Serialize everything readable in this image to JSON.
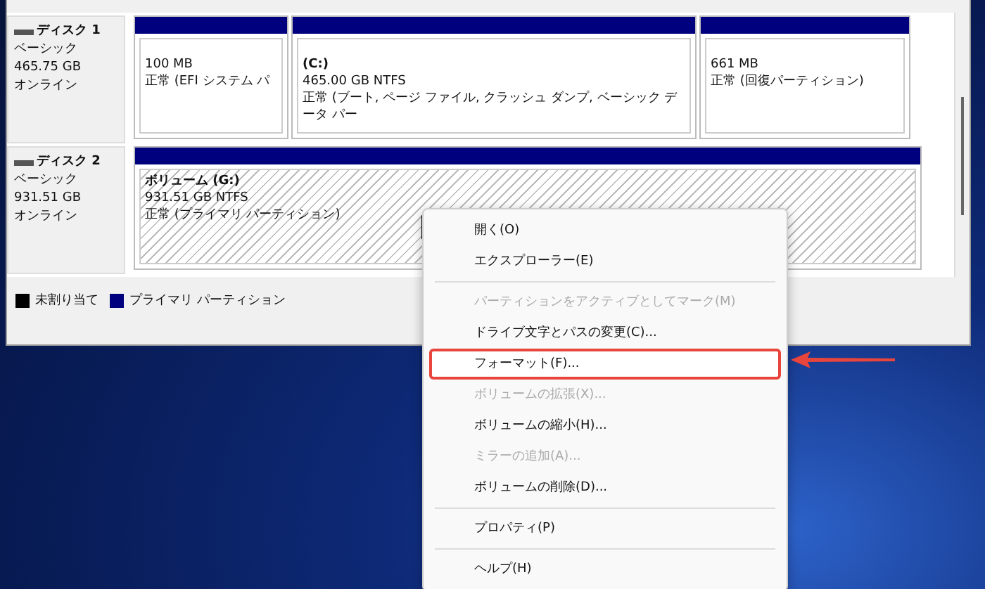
{
  "disks": [
    {
      "name": "ディスク 1",
      "type": "ベーシック",
      "size": "465.75 GB",
      "status": "オンライン",
      "partitions": [
        {
          "size": "100 MB",
          "status": "正常 (EFI システム パ",
          "selected": false
        },
        {
          "label": "(C:)",
          "size": "465.00 GB NTFS",
          "status": "正常 (ブート, ページ ファイル, クラッシュ ダンプ, ベーシック データ パー",
          "selected": false
        },
        {
          "size": "661 MB",
          "status": "正常 (回復パーティション)",
          "selected": false
        }
      ]
    },
    {
      "name": "ディスク 2",
      "type": "ベーシック",
      "size": "931.51 GB",
      "status": "オンライン",
      "partitions": [
        {
          "label": "ボリューム (G:)",
          "size": "931.51 GB NTFS",
          "status": "正常 (プライマリ パーティション)",
          "selected": true
        }
      ]
    }
  ],
  "legend": [
    {
      "label": "未割り当て",
      "color": "#000000"
    },
    {
      "label": "プライマリ パーティション",
      "color": "#00007f"
    }
  ],
  "context_menu": [
    {
      "kind": "item",
      "label": "開く(O)",
      "disabled": false,
      "highlighted": false
    },
    {
      "kind": "item",
      "label": "エクスプローラー(E)",
      "disabled": false,
      "highlighted": false
    },
    {
      "kind": "separator"
    },
    {
      "kind": "item",
      "label": "パーティションをアクティブとしてマーク(M)",
      "disabled": true,
      "highlighted": false
    },
    {
      "kind": "item",
      "label": "ドライブ文字とパスの変更(C)...",
      "disabled": false,
      "highlighted": false
    },
    {
      "kind": "item",
      "label": "フォーマット(F)...",
      "disabled": false,
      "highlighted": true
    },
    {
      "kind": "item",
      "label": "ボリュームの拡張(X)...",
      "disabled": true,
      "highlighted": false
    },
    {
      "kind": "item",
      "label": "ボリュームの縮小(H)...",
      "disabled": false,
      "highlighted": false
    },
    {
      "kind": "item",
      "label": "ミラーの追加(A)...",
      "disabled": true,
      "highlighted": false
    },
    {
      "kind": "item",
      "label": "ボリュームの削除(D)...",
      "disabled": false,
      "highlighted": false
    },
    {
      "kind": "separator"
    },
    {
      "kind": "item",
      "label": "プロパティ(P)",
      "disabled": false,
      "highlighted": false
    },
    {
      "kind": "separator"
    },
    {
      "kind": "item",
      "label": "ヘルプ(H)",
      "disabled": false,
      "highlighted": false
    }
  ]
}
